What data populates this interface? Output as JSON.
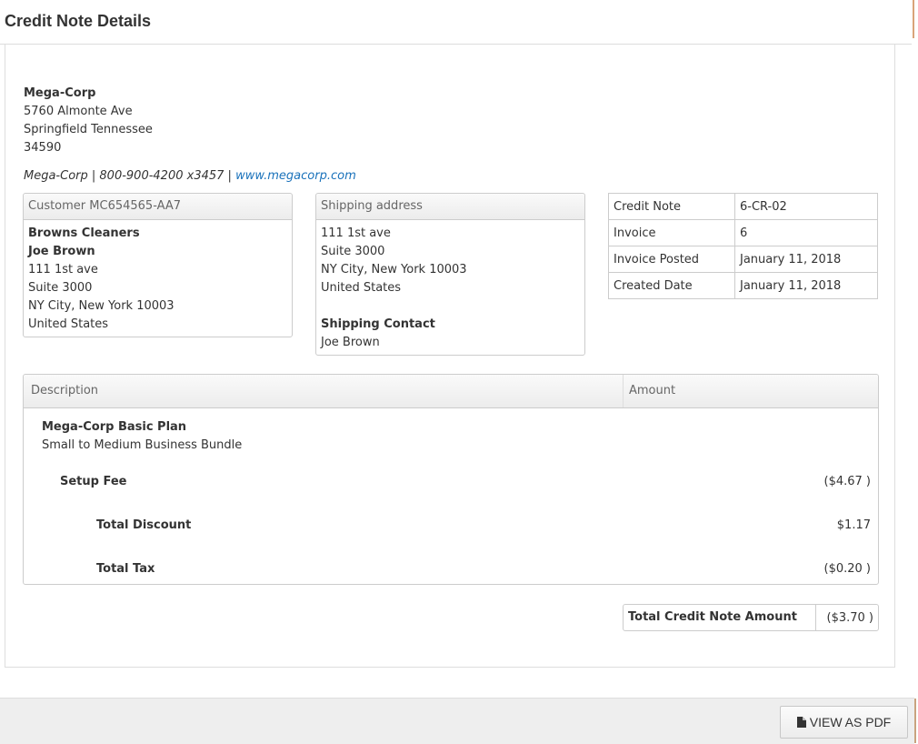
{
  "page": {
    "title": "Credit Note Details"
  },
  "company": {
    "name": "Mega-Corp",
    "address_line1": "5760 Almonte Ave",
    "address_line2": "Springfield Tennessee",
    "postal": "34590",
    "contact_text": "Mega-Corp | 800-900-4200 x3457 |",
    "website": "www.megacorp.com"
  },
  "customer": {
    "header": "Customer MC654565-AA7",
    "company": "Browns Cleaners",
    "contact": "Joe Brown",
    "line1": "111 1st ave",
    "line2": "Suite 3000",
    "city": "NY City, New York 10003",
    "country": "United States"
  },
  "shipping": {
    "header": "Shipping address",
    "line1": "111 1st ave",
    "line2": "Suite 3000",
    "city": "NY City, New York 10003",
    "country": "United States",
    "contact_label": "Shipping Contact",
    "contact_name": "Joe Brown"
  },
  "info_table": [
    {
      "label": "Credit Note",
      "value": "6-CR-02"
    },
    {
      "label": "Invoice",
      "value": "6"
    },
    {
      "label": "Invoice Posted",
      "value": "January 11, 2018"
    },
    {
      "label": "Created Date",
      "value": "January 11, 2018"
    }
  ],
  "line_items": {
    "col_description": "Description",
    "col_amount": "Amount",
    "plan_name": "Mega-Corp Basic Plan",
    "plan_desc": "Small to Medium Business Bundle",
    "setup_fee_label": "Setup Fee",
    "setup_fee_amount": "($4.67 )",
    "discount_label": "Total Discount",
    "discount_amount": "$1.17",
    "tax_label": "Total Tax",
    "tax_amount": "($0.20 )"
  },
  "total": {
    "label": "Total Credit Note Amount",
    "value": "($3.70 )"
  },
  "footer": {
    "pdf_button": "VIEW AS PDF",
    "pdf_icon": "file-icon"
  }
}
